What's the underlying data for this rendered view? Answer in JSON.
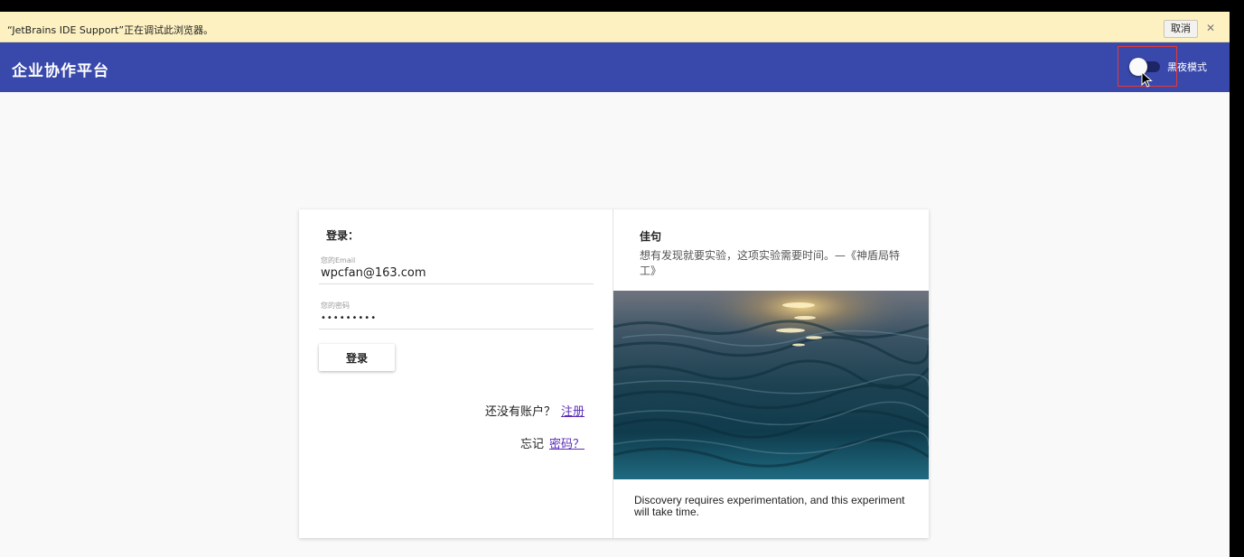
{
  "debug_bar": {
    "message": "“JetBrains IDE Support”正在调试此浏览器。",
    "cancel_label": "取消",
    "close_icon": "close-icon"
  },
  "header": {
    "title": "企业协作平台",
    "dark_mode_label": "黑夜模式",
    "dark_mode_on": false,
    "color": "#3949ab"
  },
  "login": {
    "title": "登录：",
    "email_label": "您的Email",
    "email_value": "wpcfan@163.com",
    "password_label": "您的密码",
    "password_value": "•••••••••",
    "submit_label": "登录",
    "no_account_text": "还没有账户？",
    "register_link": "注册",
    "forgot_text": "忘记",
    "forgot_link": "密码？"
  },
  "quote": {
    "title": "佳句",
    "text_cn": "想有发现就要实验，这项实验需要时间。—《神盾局特工》",
    "text_en": "Discovery requires experimentation, and this experiment will take time.",
    "image": "sea-waves-image"
  },
  "colors": {
    "link": "#5b2cb8",
    "accent_highlight": "#e53935"
  }
}
